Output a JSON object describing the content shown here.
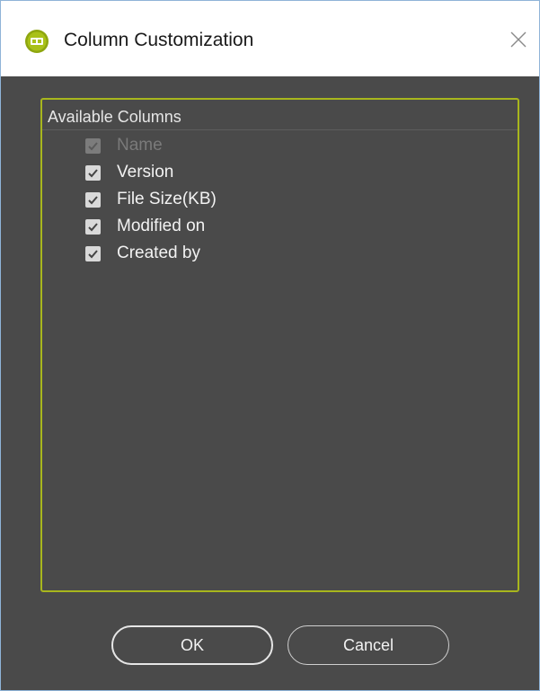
{
  "window": {
    "title": "Column Customization",
    "icon": "app-logo-icon",
    "accent_color": "#a8b61d"
  },
  "group": {
    "header": "Available Columns",
    "items": [
      {
        "label": "Name",
        "checked": true,
        "disabled": true
      },
      {
        "label": "Version",
        "checked": true,
        "disabled": false
      },
      {
        "label": "File Size(KB)",
        "checked": true,
        "disabled": false
      },
      {
        "label": "Modified on",
        "checked": true,
        "disabled": false
      },
      {
        "label": "Created by",
        "checked": true,
        "disabled": false
      }
    ]
  },
  "buttons": {
    "ok": "OK",
    "cancel": "Cancel"
  }
}
